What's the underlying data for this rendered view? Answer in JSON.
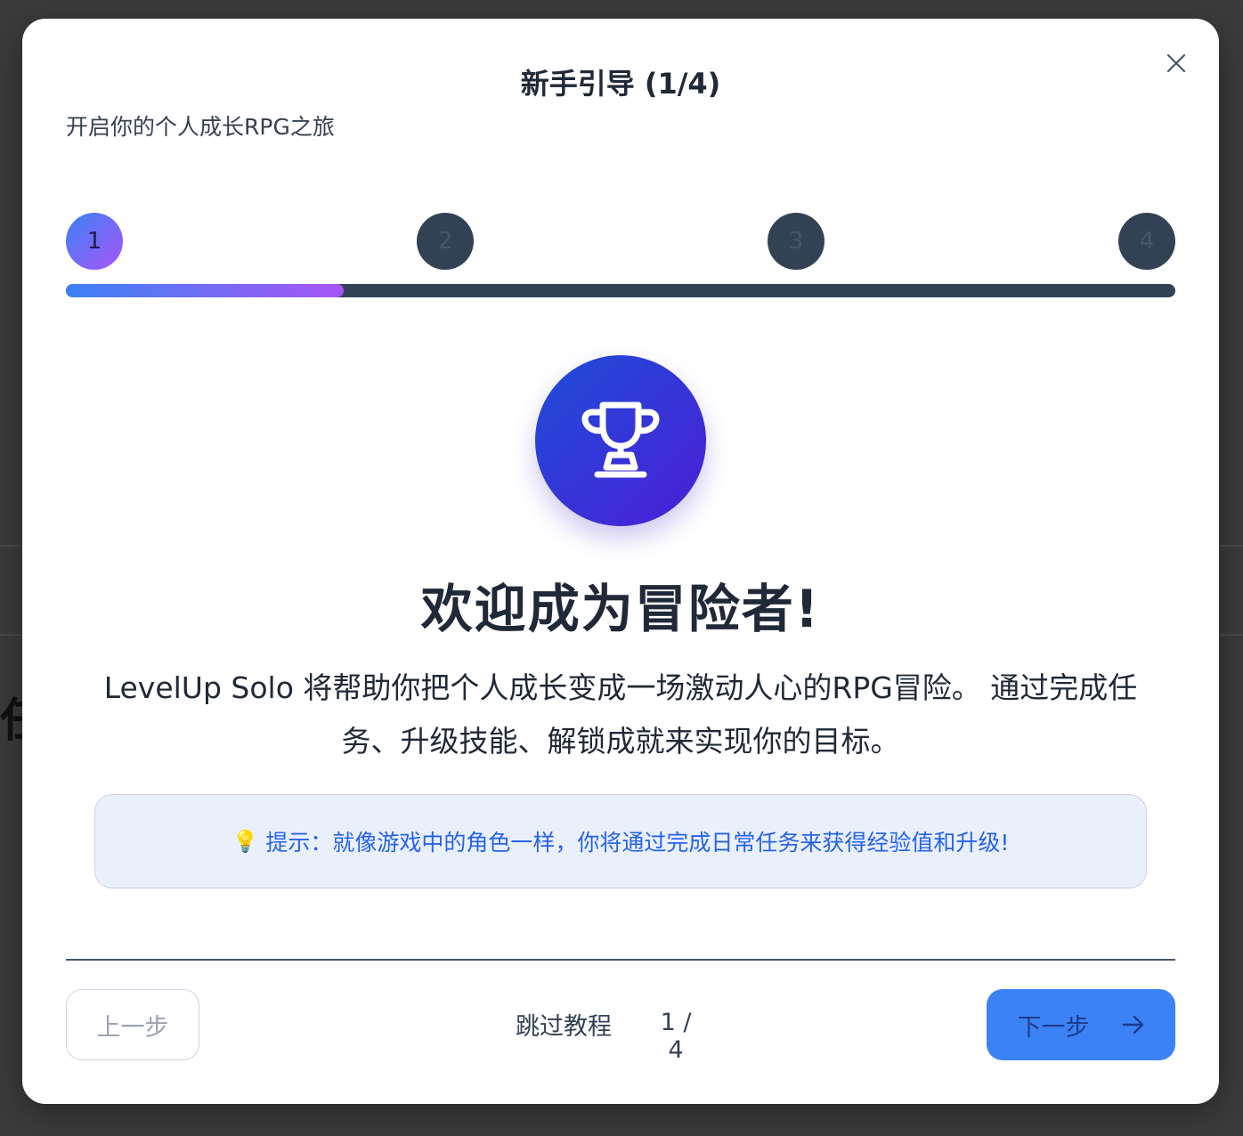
{
  "background": {
    "partial_glyph": "任"
  },
  "modal": {
    "title": "新手引导 (1/4)",
    "subtitle": "开启你的个人成长RPG之旅"
  },
  "stepper": {
    "steps": [
      "1",
      "2",
      "3",
      "4"
    ],
    "current_step": 1,
    "progress_fraction": 0.25
  },
  "content": {
    "icon": "trophy-icon",
    "heading": "欢迎成为冒险者!",
    "description": "LevelUp Solo 将帮助你把个人成长变成一场激动人心的RPG冒险。 通过完成任务、升级技能、解锁成就来实现你的目标。",
    "tip_icon": "lightbulb-icon",
    "tip": "提示：就像游戏中的角色一样，你将通过完成日常任务来获得经验值和升级!"
  },
  "footer": {
    "prev_label": "上一步",
    "skip_label": "跳过教程",
    "page_indicator": "1 / 4",
    "next_label": "下一步"
  },
  "colors": {
    "accent_start": "#3b82f6",
    "accent_end": "#a855f7",
    "trophy_start": "#1d4ed8",
    "trophy_end": "#4c1dd6",
    "inactive_step": "#334155"
  }
}
